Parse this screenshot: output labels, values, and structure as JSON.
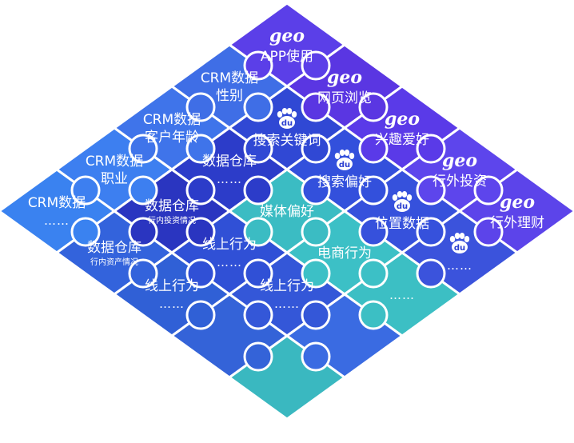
{
  "logos": {
    "geo": "geo",
    "baidu": "du"
  },
  "pieces": [
    {
      "id": "p1",
      "row": 0,
      "col": 0,
      "color": "#5b3fe8",
      "logo": "geo",
      "lines": [
        "APP使用"
      ]
    },
    {
      "id": "p2",
      "row": 1,
      "col": 0,
      "color": "#3f6ee6",
      "lines": [
        "CRM数据",
        "性别"
      ]
    },
    {
      "id": "p3",
      "row": 0,
      "col": 1,
      "color": "#5a36e2",
      "logo": "geo",
      "lines": [
        "网页浏览"
      ]
    },
    {
      "id": "p4",
      "row": 2,
      "col": 0,
      "color": "#3f74ea",
      "lines": [
        "CRM数据",
        "客户年龄"
      ]
    },
    {
      "id": "p5",
      "row": 1,
      "col": 1,
      "color": "#3048d4",
      "logo": "baidu",
      "lines": [
        "搜索关键词"
      ]
    },
    {
      "id": "p6",
      "row": 0,
      "col": 2,
      "color": "#5a3ae8",
      "logo": "geo",
      "lines": [
        "兴趣爱好"
      ]
    },
    {
      "id": "p7",
      "row": 3,
      "col": 0,
      "color": "#3d7ff0",
      "lines": [
        "CRM数据",
        "职业"
      ]
    },
    {
      "id": "p8",
      "row": 2,
      "col": 1,
      "color": "#2c3cc9",
      "lines": [
        "数据仓库",
        "……"
      ]
    },
    {
      "id": "p9",
      "row": 1,
      "col": 2,
      "color": "#3350dc",
      "logo": "baidu",
      "lines": [
        "搜索偏好"
      ]
    },
    {
      "id": "p10",
      "row": 0,
      "col": 3,
      "color": "#5d45ec",
      "logo": "geo",
      "lines": [
        "行外投资"
      ]
    },
    {
      "id": "p11",
      "row": 4,
      "col": 0,
      "color": "#3a82f0",
      "lines": [
        "CRM数据",
        "……"
      ]
    },
    {
      "id": "p12",
      "row": 3,
      "col": 1,
      "color": "#2a35c0",
      "lines": [
        "数据仓库"
      ],
      "sub": "行内投资情况"
    },
    {
      "id": "p13",
      "row": 2,
      "col": 2,
      "color": "#3bbcc3",
      "lines": [
        "媒体偏好"
      ]
    },
    {
      "id": "p14",
      "row": 1,
      "col": 3,
      "color": "#3651dc",
      "logo": "baidu",
      "lines": [
        "位置数据"
      ]
    },
    {
      "id": "p15",
      "row": 0,
      "col": 4,
      "color": "#5c44ea",
      "logo": "geo",
      "lines": [
        "行外理财"
      ]
    },
    {
      "id": "p16",
      "row": 4,
      "col": 1,
      "color": "#3363dc",
      "lines": [
        "数据仓库"
      ],
      "sub": "行内资产情况"
    },
    {
      "id": "p17",
      "row": 3,
      "col": 2,
      "color": "#3050d6",
      "lines": [
        "线上行为",
        "……"
      ]
    },
    {
      "id": "p18",
      "row": 2,
      "col": 3,
      "color": "#3cc0c6",
      "lines": [
        "电商行为"
      ]
    },
    {
      "id": "p19",
      "row": 1,
      "col": 4,
      "color": "#3b53dc",
      "logo": "baidu",
      "lines": [
        "……"
      ]
    },
    {
      "id": "p20",
      "row": 4,
      "col": 2,
      "color": "#3060d6",
      "lines": [
        "线上行为",
        "……"
      ]
    },
    {
      "id": "p21",
      "row": 3,
      "col": 3,
      "color": "#3457d8",
      "lines": [
        "线上行为",
        "……"
      ]
    },
    {
      "id": "p22",
      "row": 2,
      "col": 4,
      "color": "#3cbfc4",
      "lines": [
        "……"
      ]
    },
    {
      "id": "p23",
      "row": 4,
      "col": 3,
      "color": "#3463d8",
      "lines": []
    },
    {
      "id": "p24",
      "row": 3,
      "col": 4,
      "color": "#3a6be2",
      "lines": []
    },
    {
      "id": "p25",
      "row": 4,
      "col": 4,
      "color": "#3ab8c0",
      "lines": []
    }
  ]
}
